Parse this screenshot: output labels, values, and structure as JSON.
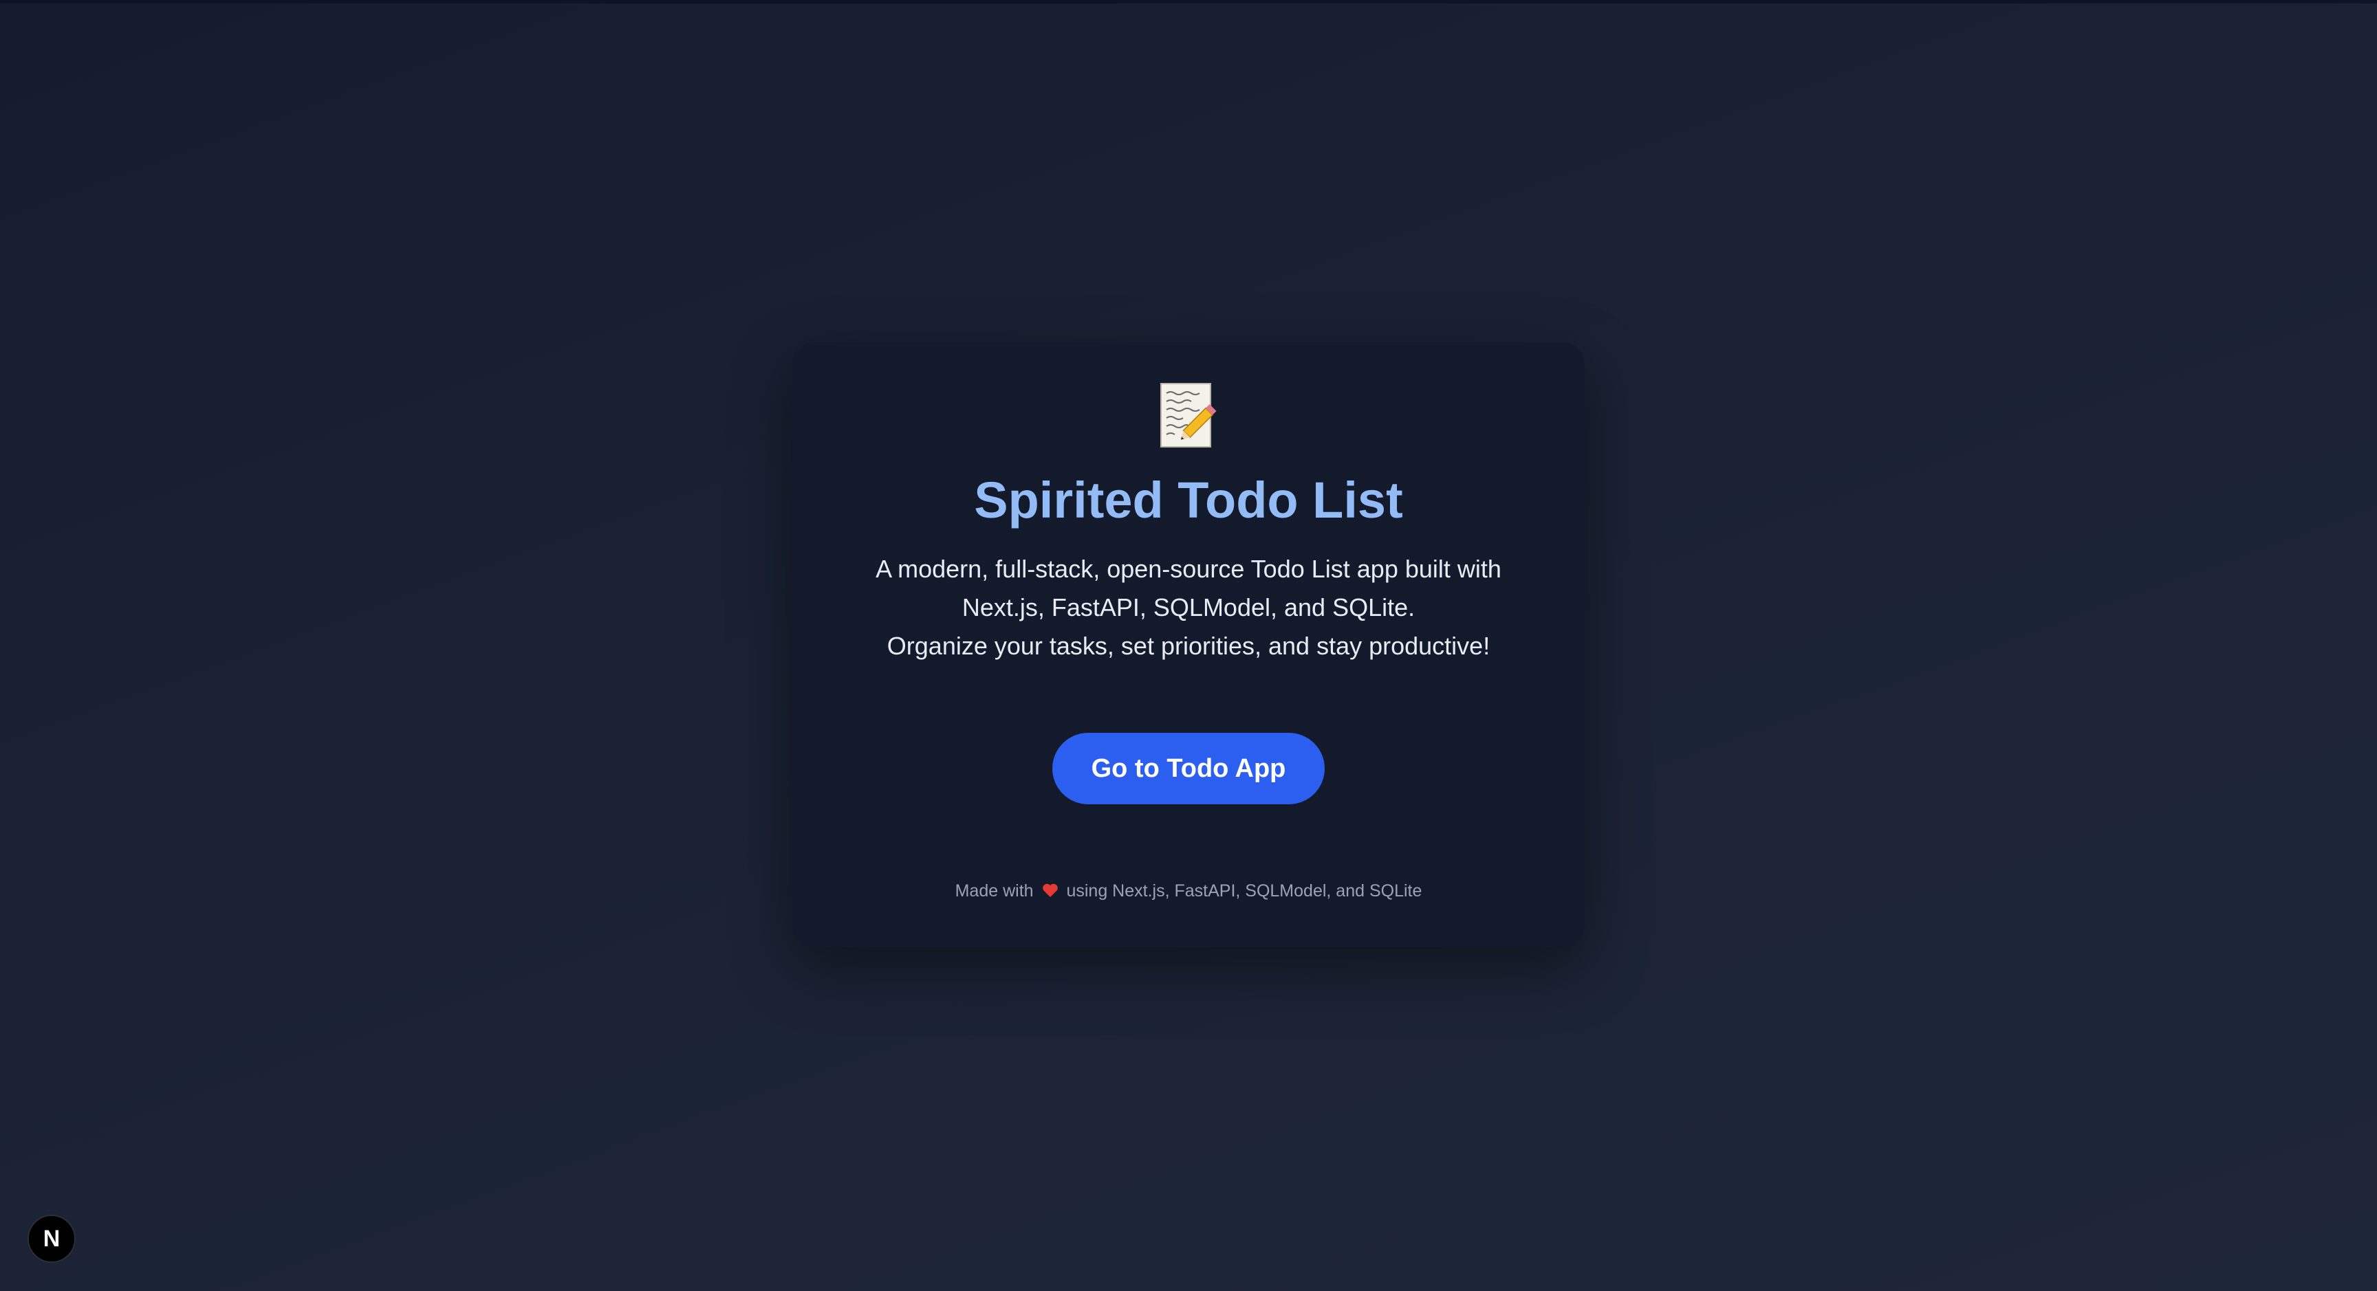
{
  "card": {
    "icon": "memo-pencil-icon",
    "title": "Spirited Todo List",
    "description_lines": [
      "A modern, full-stack, open-source Todo List app built with",
      "Next.js, FastAPI, SQLModel, and SQLite.",
      "Organize your tasks, set priorities, and stay productive!"
    ],
    "button_label": "Go to Todo App",
    "footer": {
      "before_heart": "Made with",
      "heart_icon": "heart-icon",
      "after_heart": "using Next.js, FastAPI, SQLModel, and SQLite"
    }
  },
  "next_badge": {
    "label": "N",
    "icon": "nextjs-logo-icon"
  },
  "colors": {
    "background": "#1a2234",
    "card": "#131a2b",
    "title": "#93bbf6",
    "button": "#2c5ff0",
    "footer_text": "#9aa3b5",
    "heart": "#e53935"
  }
}
